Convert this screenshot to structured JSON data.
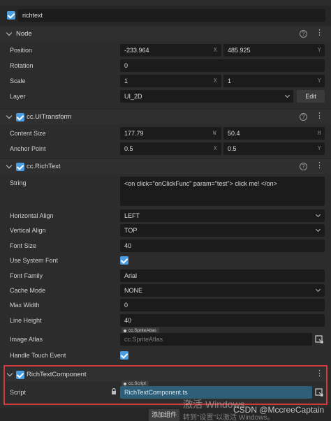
{
  "node_name": "richtext",
  "sections": {
    "node": "Node",
    "uitransform": "cc.UITransform",
    "richtext": "cc.RichText",
    "component": "RichTextComponent"
  },
  "node_props": {
    "position_label": "Position",
    "position_x": "-233.964",
    "position_y": "485.925",
    "rotation_label": "Rotation",
    "rotation_value": "0",
    "scale_label": "Scale",
    "scale_x": "1",
    "scale_y": "1",
    "layer_label": "Layer",
    "layer_value": "UI_2D",
    "edit_label": "Edit"
  },
  "axis": {
    "x": "X",
    "y": "Y",
    "w": "W",
    "h": "H"
  },
  "transform_props": {
    "content_size_label": "Content Size",
    "width": "177.79",
    "height": "50.4",
    "anchor_label": "Anchor Point",
    "anchor_x": "0.5",
    "anchor_y": "0.5"
  },
  "richtext_props": {
    "string_label": "String",
    "string_value": "<on click=\"onClickFunc\" param=\"test\"> click me! </on>",
    "halign_label": "Horizontal Align",
    "halign_value": "LEFT",
    "valign_label": "Vertical Align",
    "valign_value": "TOP",
    "font_size_label": "Font Size",
    "font_size_value": "40",
    "system_font_label": "Use System Font",
    "font_family_label": "Font Family",
    "font_family_value": "Arial",
    "cache_mode_label": "Cache Mode",
    "cache_mode_value": "NONE",
    "max_width_label": "Max Width",
    "max_width_value": "0",
    "line_height_label": "Line Height",
    "line_height_value": "40",
    "image_atlas_label": "Image Atlas",
    "image_atlas_tag": "cc.SpriteAtlas",
    "image_atlas_value": "cc.SpriteAtlas",
    "touch_label": "Handle Touch Event"
  },
  "component_props": {
    "script_label": "Script",
    "script_tag": "cc.Script",
    "script_value": "RichTextComponent.ts"
  },
  "footer": {
    "add_component": "添加组件",
    "activate_line": "转到\"设置\"以激活 Windows。",
    "activate_title": "激活 Windows",
    "csdn": "CSDN @MccreeCaptain"
  },
  "colors": {
    "checkbox": "#4a9de0",
    "highlight_box": "#d23b3b",
    "script_field": "#2f5f78"
  }
}
